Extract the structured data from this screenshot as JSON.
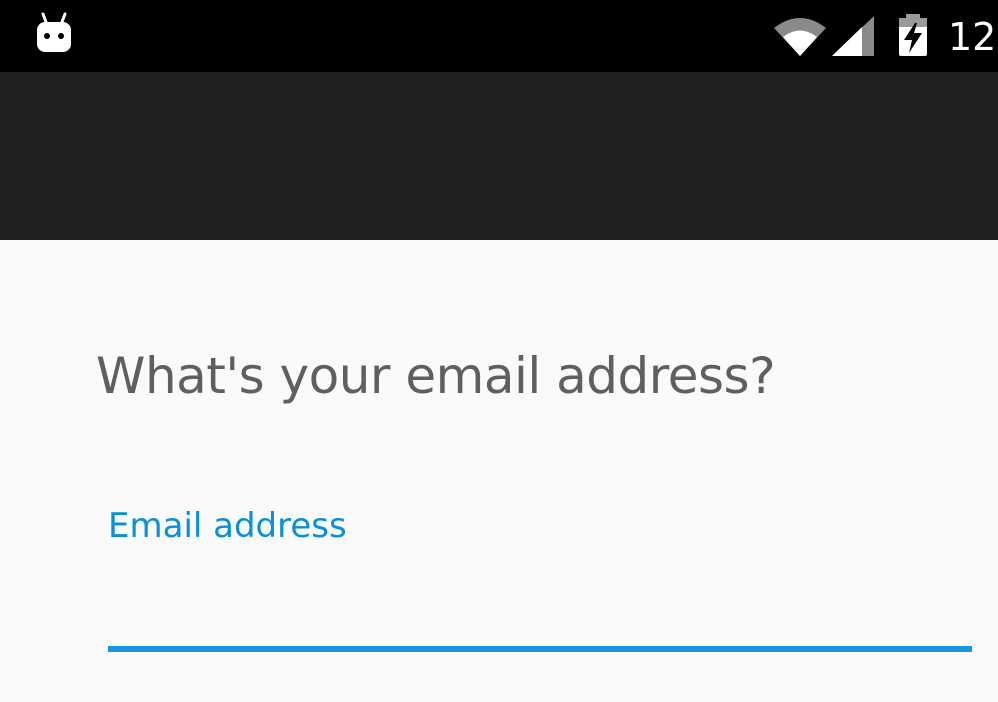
{
  "status_bar": {
    "time": "12",
    "icons": {
      "notification": "android-robot-icon",
      "wifi": "wifi-icon",
      "signal": "cell-signal-icon",
      "battery": "battery-charging-icon"
    }
  },
  "main": {
    "question": "What's your email address?",
    "email_field": {
      "label": "Email address",
      "value": "",
      "accent_color": "#1a96e0"
    }
  },
  "colors": {
    "status_bar": "#000000",
    "app_bar": "#212121",
    "background": "#fafafa",
    "accent": "#0a8fd9"
  }
}
